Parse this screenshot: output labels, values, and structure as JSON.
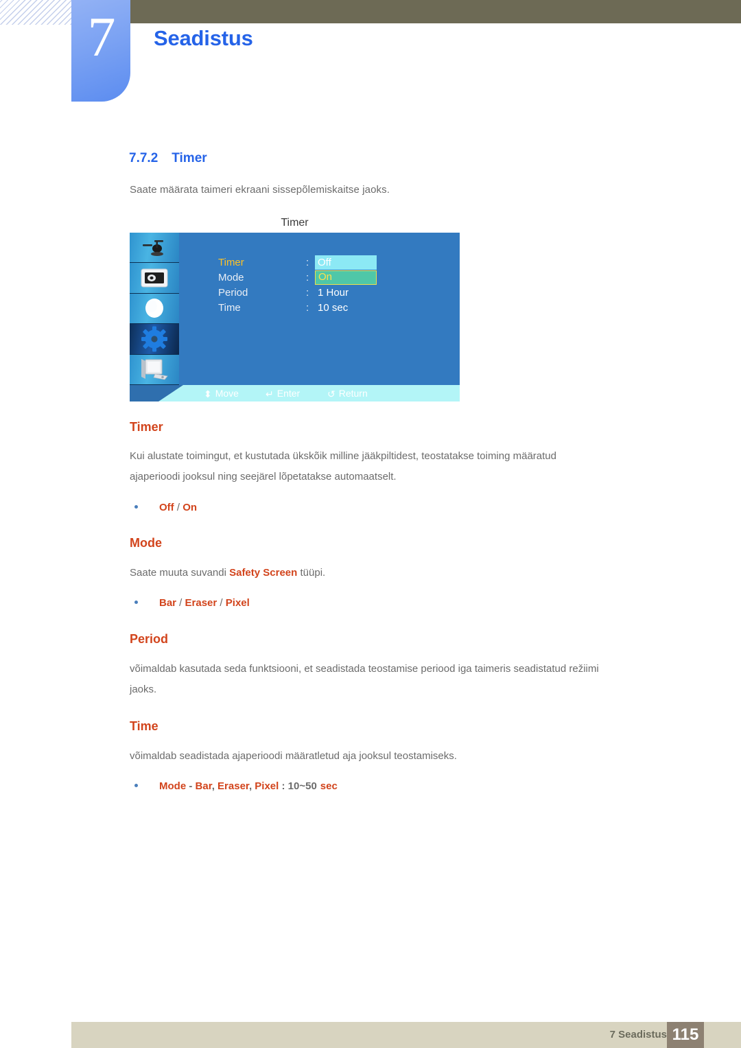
{
  "header": {
    "chapter_number": "7",
    "chapter_title": "Seadistus"
  },
  "section": {
    "number": "7.7.2",
    "title": "Timer",
    "intro": "Saate määrata taimeri ekraani sissepõlemiskaitse jaoks."
  },
  "osd": {
    "title": "Timer",
    "sidebar_icons": [
      "input-source-icon",
      "picture-icon",
      "sound-icon",
      "setup-gear-icon",
      "multi-control-icon"
    ],
    "rows": [
      {
        "label": "Timer",
        "colon": ":",
        "value": "Off",
        "style": "chip-cyan",
        "label_active": true
      },
      {
        "label": "Mode",
        "colon": ":",
        "value": "On",
        "style": "chip-green",
        "label_active": false
      },
      {
        "label": "Period",
        "colon": ":",
        "value": "1 Hour",
        "style": "plain",
        "label_active": false
      },
      {
        "label": "Time",
        "colon": ":",
        "value": "10 sec",
        "style": "plain",
        "label_active": false
      }
    ],
    "hints": [
      {
        "icon": "move-updown-icon",
        "glyph": "⬍",
        "label": "Move"
      },
      {
        "icon": "enter-icon",
        "glyph": "↵",
        "label": "Enter"
      },
      {
        "icon": "return-icon",
        "glyph": "↺",
        "label": "Return"
      }
    ],
    "colors": {
      "panel": "#337ac0",
      "footbar": "#b3f5f7",
      "chip_cyan": "#8ce9f5",
      "chip_green": "#4fc7a8",
      "active_label": "#ffc326"
    }
  },
  "subsections": {
    "timer": {
      "heading": "Timer",
      "paragraph_line1": "Kui alustate toimingut, et kustutada ükskõik milline jääkpiltidest, teostatakse toiming määratud",
      "paragraph_line2": "ajaperioodi jooksul ning seejärel lõpetatakse automaatselt.",
      "bullet_a": "Off",
      "bullet_sep": " / ",
      "bullet_b": "On"
    },
    "mode": {
      "heading": "Mode",
      "para_pre": "Saate muuta suvandi ",
      "para_hl": "Safety Screen",
      "para_post": " tüüpi.",
      "bullet_a": "Bar",
      "bullet_sep1": " / ",
      "bullet_b": "Eraser",
      "bullet_sep2": " / ",
      "bullet_c": "Pixel"
    },
    "period": {
      "heading": "Period",
      "paragraph_line1": "võimaldab kasutada seda funktsiooni, et seadistada teostamise periood iga taimeris seadistatud režiimi",
      "paragraph_line2": "jaoks."
    },
    "time": {
      "heading": "Time",
      "paragraph": "võimaldab seadistada ajaperioodi määratletud aja jooksul teostamiseks.",
      "bullet_mode": "Mode",
      "bullet_dash": " - ",
      "bullet_bar": "Bar",
      "bullet_c1": ", ",
      "bullet_eraser": "Eraser",
      "bullet_c2": ", ",
      "bullet_pixel": "Pixel",
      "bullet_colon": " : ",
      "bullet_range": "10~50",
      "bullet_unit": "sec"
    }
  },
  "footer": {
    "label": "7 Seadistus",
    "page": "115"
  }
}
